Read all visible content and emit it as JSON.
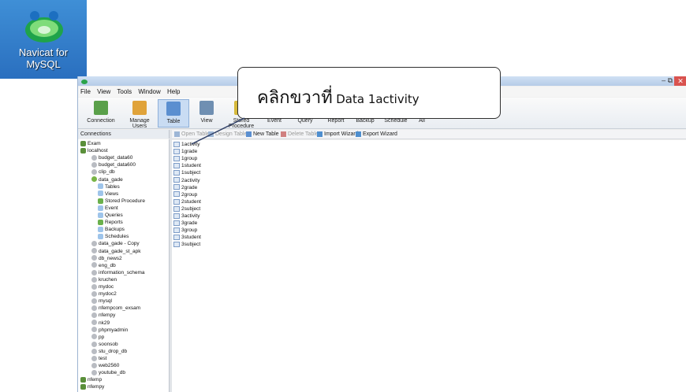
{
  "desktop_icon": {
    "line1": "Navicat for",
    "line2": "MySQL"
  },
  "menu": [
    "File",
    "View",
    "Tools",
    "Window",
    "Help"
  ],
  "ribbon": [
    {
      "label": "Connection",
      "icon": "connection-icon",
      "color": "#5aa04a"
    },
    {
      "label": "Manage Users",
      "icon": "users-icon",
      "color": "#e0a33a"
    },
    {
      "label": "Table",
      "icon": "table-icon",
      "color": "#5b8fd0",
      "active": true
    },
    {
      "label": "View",
      "icon": "view-icon",
      "color": "#6f8fb2"
    },
    {
      "label": "Stored Procedure",
      "icon": "procedure-icon",
      "color": "#d6b93b"
    },
    {
      "label": "Event",
      "icon": "event-icon",
      "color": "#8aa4c8"
    },
    {
      "label": "Query",
      "icon": "query-icon",
      "color": "#7d9cc7"
    },
    {
      "label": "Report",
      "icon": "report-icon",
      "color": "#3aa0c8"
    },
    {
      "label": "Backup",
      "icon": "backup-icon",
      "color": "#3b78c2"
    },
    {
      "label": "Schedule",
      "icon": "schedule-icon",
      "color": "#4f8fcf"
    },
    {
      "label": "All",
      "icon": "all-icon",
      "color": "#c94a4a"
    }
  ],
  "connections_label": "Connections",
  "tree": [
    {
      "label": "Exam",
      "type": "conn",
      "indent": 0
    },
    {
      "label": "localhost",
      "type": "conn",
      "indent": 0
    },
    {
      "label": "budget_data60",
      "type": "db",
      "indent": 2
    },
    {
      "label": "budget_data600",
      "type": "db",
      "indent": 2
    },
    {
      "label": "clip_db",
      "type": "db",
      "indent": 2
    },
    {
      "label": "data_gade",
      "type": "dbopen",
      "indent": 2
    },
    {
      "label": "Tables",
      "type": "folder",
      "indent": 3
    },
    {
      "label": "Views",
      "type": "folder",
      "indent": 3
    },
    {
      "label": "Stored Procedure",
      "type": "grn",
      "indent": 3
    },
    {
      "label": "Event",
      "type": "folder",
      "indent": 3
    },
    {
      "label": "Queries",
      "type": "folder",
      "indent": 3
    },
    {
      "label": "Reports",
      "type": "grn",
      "indent": 3
    },
    {
      "label": "Backups",
      "type": "folder",
      "indent": 3
    },
    {
      "label": "Schedules",
      "type": "folder",
      "indent": 3
    },
    {
      "label": "data_gade - Copy",
      "type": "db",
      "indent": 2
    },
    {
      "label": "data_gade_st_apk",
      "type": "db",
      "indent": 2
    },
    {
      "label": "db_news2",
      "type": "db",
      "indent": 2
    },
    {
      "label": "eng_db",
      "type": "db",
      "indent": 2
    },
    {
      "label": "information_schema",
      "type": "db",
      "indent": 2
    },
    {
      "label": "kruchen",
      "type": "db",
      "indent": 2
    },
    {
      "label": "mydoc",
      "type": "db",
      "indent": 2
    },
    {
      "label": "mydoc2",
      "type": "db",
      "indent": 2
    },
    {
      "label": "mysql",
      "type": "db",
      "indent": 2
    },
    {
      "label": "nfempcom_exsam",
      "type": "db",
      "indent": 2
    },
    {
      "label": "nfempy",
      "type": "db",
      "indent": 2
    },
    {
      "label": "nk29",
      "type": "db",
      "indent": 2
    },
    {
      "label": "phpmyadmin",
      "type": "db",
      "indent": 2
    },
    {
      "label": "pp",
      "type": "db",
      "indent": 2
    },
    {
      "label": "soonsob",
      "type": "db",
      "indent": 2
    },
    {
      "label": "stu_drop_db",
      "type": "db",
      "indent": 2
    },
    {
      "label": "test",
      "type": "db",
      "indent": 2
    },
    {
      "label": "web2560",
      "type": "db",
      "indent": 2
    },
    {
      "label": "youtube_db",
      "type": "db",
      "indent": 2
    },
    {
      "label": "nfemp",
      "type": "conn",
      "indent": 0
    },
    {
      "label": "nfempy",
      "type": "conn",
      "indent": 0
    }
  ],
  "table_toolbar": [
    {
      "label": "Open Table",
      "enabled": false
    },
    {
      "label": "Design Table",
      "enabled": false
    },
    {
      "label": "New Table",
      "enabled": true
    },
    {
      "label": "Delete Table",
      "enabled": false
    },
    {
      "label": "Import Wizard",
      "enabled": true
    },
    {
      "label": "Export Wizard",
      "enabled": true
    }
  ],
  "tables": [
    "1activity",
    "1grade",
    "1group",
    "1student",
    "1subject",
    "2activity",
    "2grade",
    "2group",
    "2student",
    "2subject",
    "3activity",
    "3grade",
    "3group",
    "3student",
    "3subject"
  ],
  "callout": {
    "thai": "คลิกขวาที่",
    "english": "Data  1activity"
  }
}
